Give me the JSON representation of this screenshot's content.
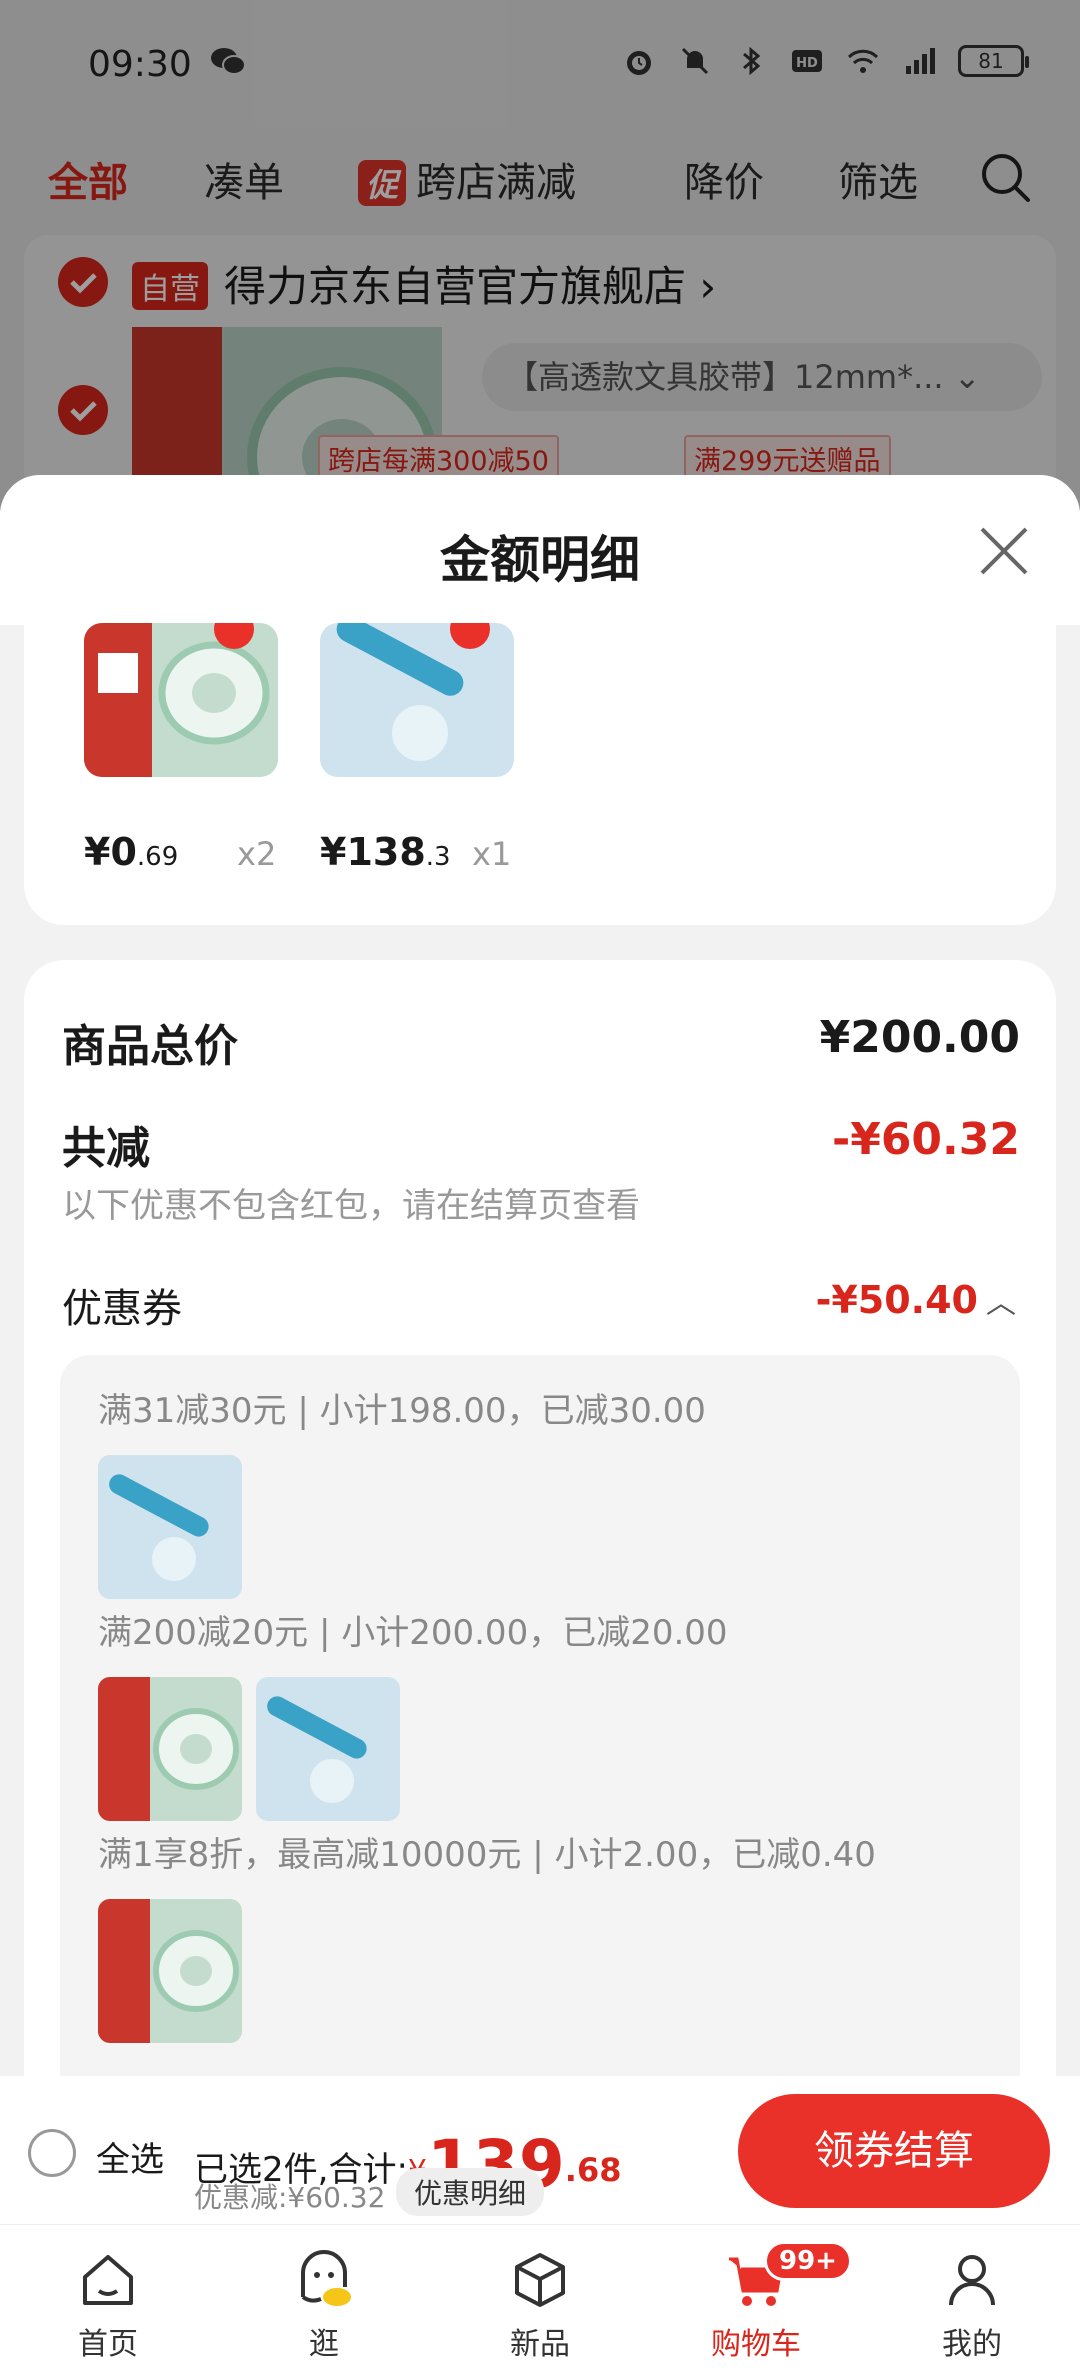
{
  "status_bar": {
    "time": "09:30",
    "battery": "81"
  },
  "filter_bar": {
    "items": [
      "全部",
      "凑单",
      "跨店满减",
      "降价",
      "筛选"
    ],
    "promo_tag": "促"
  },
  "store": {
    "self_tag": "自营",
    "name": "得力京东自营官方旗舰店",
    "sku": "【高透款文具胶带】12mm*...",
    "promos": [
      "跨店每满300减50",
      "满299元送赠品"
    ]
  },
  "sheet": {
    "title": "金额明细",
    "goods": [
      {
        "price_int": "¥0",
        "price_dec": ".69",
        "qty": "x2"
      },
      {
        "price_int": "¥138",
        "price_dec": ".3",
        "qty": "x1"
      }
    ],
    "total_label": "商品总价",
    "total_value": "¥200.00",
    "discount_label": "共减",
    "discount_value": "-¥60.32",
    "discount_note": "以下优惠不包含红包，请在结算页查看",
    "coupon_label": "优惠券",
    "coupon_value": "-¥50.40",
    "coupon_rules": [
      "满31减30元 | 小计198.00，已减30.00",
      "满200减20元 | 小计200.00，已减20.00",
      "满1享8折，最高减10000元 | 小计2.00，已减0.40"
    ]
  },
  "checkout": {
    "select_all": "全选",
    "summary_prefix": "已选2件,合计:",
    "currency": "¥",
    "total_int": "139",
    "total_dec": ".68",
    "discount": "优惠减:¥60.32",
    "detail_link": "优惠明细",
    "button": "领券结算"
  },
  "tabs": [
    {
      "label": "首页",
      "icon": "home-icon"
    },
    {
      "label": "逛",
      "icon": "mascot-icon"
    },
    {
      "label": "新品",
      "icon": "box-icon"
    },
    {
      "label": "购物车",
      "icon": "cart-icon",
      "badge": "99+"
    },
    {
      "label": "我的",
      "icon": "user-icon"
    }
  ],
  "colors": {
    "accent": "#d9261c",
    "button": "#e9312a"
  }
}
